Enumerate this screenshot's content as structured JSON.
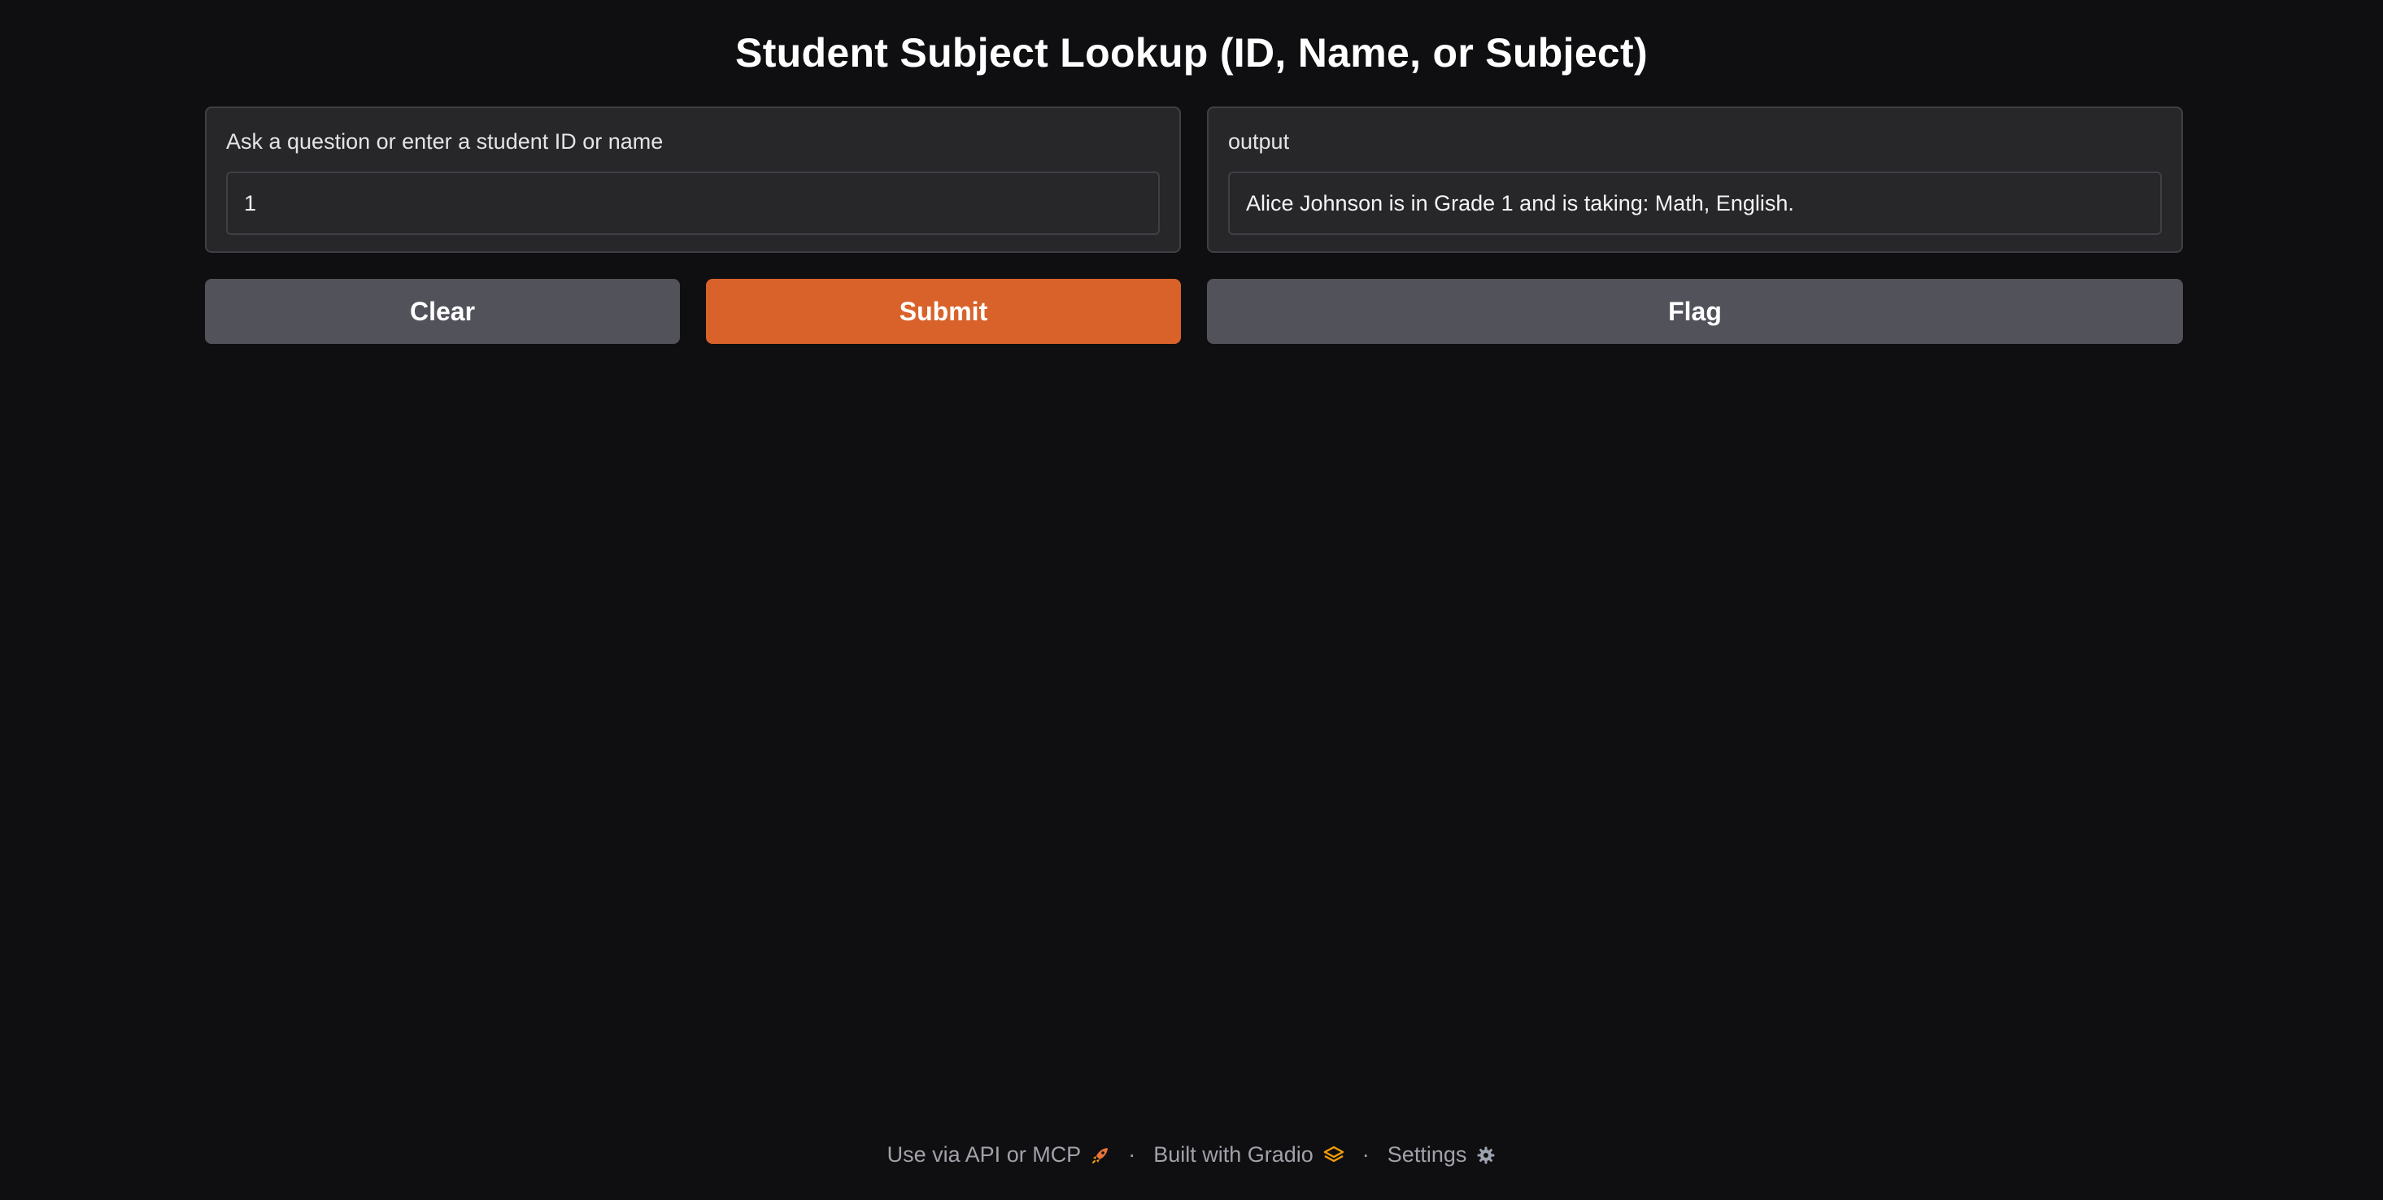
{
  "header": {
    "title": "Student Subject Lookup (ID, Name, or Subject)"
  },
  "input_panel": {
    "label": "Ask a question or enter a student ID or name",
    "value": "1"
  },
  "output_panel": {
    "label": "output",
    "value": "Alice Johnson is in Grade 1 and is taking: Math, English."
  },
  "buttons": {
    "clear_label": "Clear",
    "submit_label": "Submit",
    "flag_label": "Flag"
  },
  "footer": {
    "api_label": "Use via API or MCP",
    "api_icon": "rocket-icon",
    "built_label": "Built with Gradio",
    "built_icon": "gradio-logo-icon",
    "settings_label": "Settings",
    "settings_icon": "gear-icon",
    "separator": "·"
  },
  "colors": {
    "background": "#0f0f11",
    "panel": "#27272a",
    "border": "#3f3f46",
    "primary": "#d9622b",
    "secondary": "#52525b"
  }
}
